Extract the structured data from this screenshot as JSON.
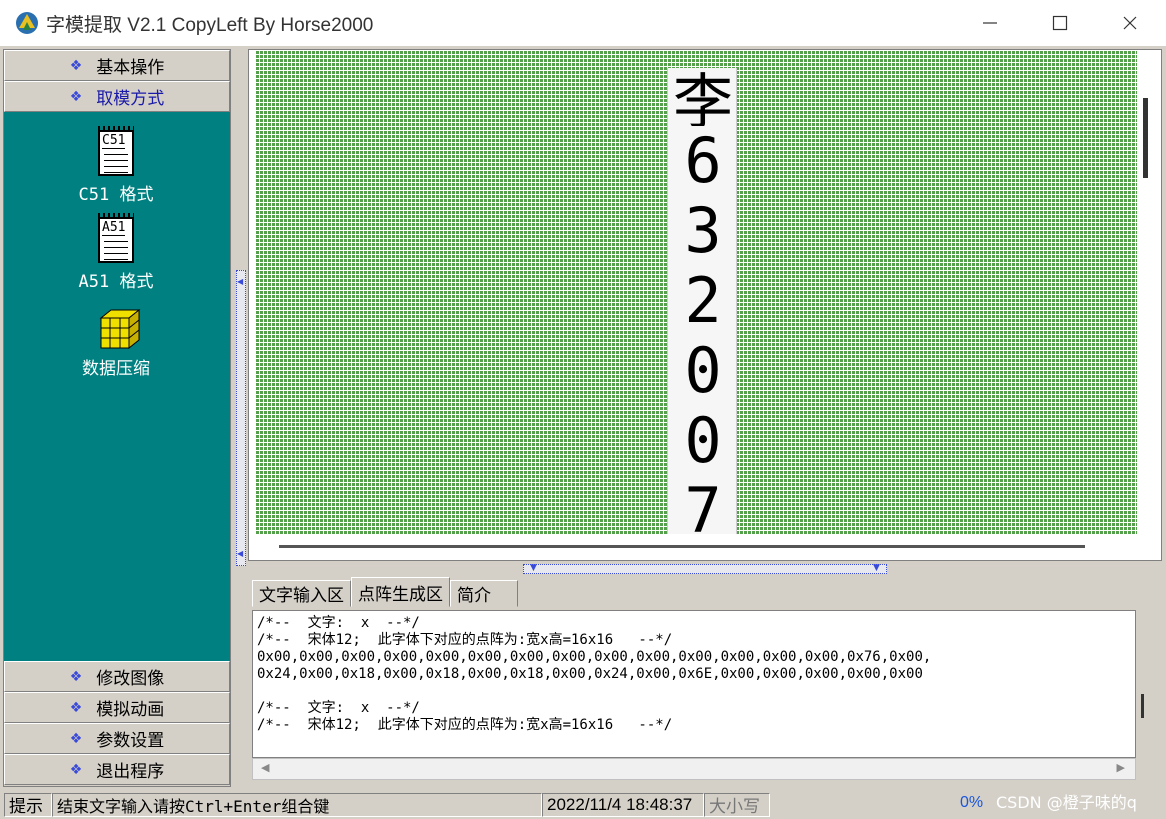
{
  "window": {
    "title": "字模提取 V2.1  CopyLeft By Horse2000",
    "min_icon": "—",
    "max_icon": "☐",
    "close_icon": "✕"
  },
  "nav": {
    "bullet": "❖",
    "top_items": [
      {
        "label": "基本操作"
      },
      {
        "label": "取模方式",
        "active": true
      }
    ],
    "panel_items": [
      {
        "label": "C51 格式",
        "icon_text": "C51",
        "icon": "document-icon"
      },
      {
        "label": "A51 格式",
        "icon_text": "A51",
        "icon": "document-icon"
      },
      {
        "label": "数据压缩",
        "icon": "cube-icon"
      }
    ],
    "bottom_items": [
      {
        "label": "修改图像"
      },
      {
        "label": "模拟动画"
      },
      {
        "label": "参数设置"
      },
      {
        "label": "退出程序"
      }
    ]
  },
  "canvas": {
    "glyphs": [
      "李",
      "6",
      "3",
      "2",
      "0",
      "0",
      "7"
    ]
  },
  "tabs": [
    {
      "label": "文字输入区"
    },
    {
      "label": "点阵生成区",
      "active": true
    },
    {
      "label": "简介"
    }
  ],
  "output": {
    "lines": [
      "/*--  文字:  x  --*/",
      "/*--  宋体12;  此字体下对应的点阵为:宽x高=16x16   --*/",
      "0x00,0x00,0x00,0x00,0x00,0x00,0x00,0x00,0x00,0x00,0x00,0x00,0x00,0x00,0x76,0x00,",
      "0x24,0x00,0x18,0x00,0x18,0x00,0x18,0x00,0x24,0x00,0x6E,0x00,0x00,0x00,0x00,0x00",
      "",
      "/*--  文字:  x  --*/",
      "/*--  宋体12;  此字体下对应的点阵为:宽x高=16x16   --*/"
    ]
  },
  "status": {
    "hint": "提示",
    "message": "结束文字输入请按Ctrl+Enter组合键",
    "datetime": "2022/11/4 18:48:37",
    "caps": "大小写",
    "progress": "0%"
  },
  "watermark": "CSDN @橙子味的q"
}
